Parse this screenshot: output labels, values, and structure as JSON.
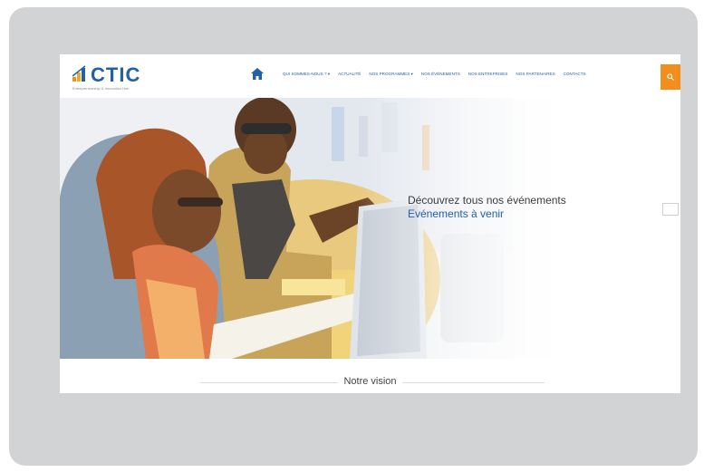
{
  "logo": {
    "text": "CTIC",
    "tagline": "Entrepreneurship & Innovation Hub"
  },
  "nav": {
    "items": [
      {
        "label": "Qui sommes-nous ? ▾"
      },
      {
        "label": "Actualité"
      },
      {
        "label": "Nos programmes ▾"
      },
      {
        "label": "Nos événements"
      },
      {
        "label": "Nos entreprises"
      },
      {
        "label": "Nos partenaires"
      },
      {
        "label": "Contacts"
      }
    ]
  },
  "hero": {
    "title": "Découvrez tous nos événements",
    "link": "Evénements à venir"
  },
  "section": {
    "vision": "Notre vision"
  },
  "colors": {
    "frame": "#d2d3d4",
    "brand_blue": "#2260a9",
    "accent_orange": "#f28e1c"
  }
}
